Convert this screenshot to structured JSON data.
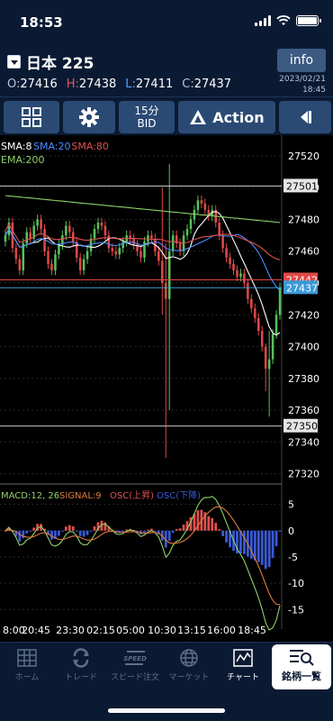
{
  "status_bar": {
    "time": "18:53"
  },
  "header": {
    "symbol": "日本 225",
    "info_label": "info",
    "ohlc": [
      {
        "label": "O:",
        "value": "27416",
        "color": "#b6c3d6"
      },
      {
        "label": "H:",
        "value": "27438",
        "color": "#e05a5a"
      },
      {
        "label": "L:",
        "value": "27411",
        "color": "#5aa0ff"
      },
      {
        "label": "C:",
        "value": "27437",
        "color": "#b6c3d6"
      }
    ],
    "date": "2023/02/21",
    "time": "18:45"
  },
  "toolbar": {
    "grid_icon": "grid-icon",
    "settings_icon": "gear-icon",
    "timeframe": "15分",
    "price_type": "BID",
    "action_label": "Action",
    "play_icon": "step-back-icon"
  },
  "chart_data": {
    "type": "candlestick",
    "title": "",
    "indicators": [
      {
        "label": "SMA:8",
        "color": "#ffffff"
      },
      {
        "label": "SMA:20",
        "color": "#4a8cff"
      },
      {
        "label": "SMA:80",
        "color": "#e05050"
      },
      {
        "label": "EMA:200",
        "color": "#8ed26a"
      }
    ],
    "y_ticks": [
      27520,
      27500,
      27480,
      27460,
      27440,
      27420,
      27400,
      27380,
      27360,
      27340,
      27320
    ],
    "ylim": [
      27313,
      27533
    ],
    "price_tags": [
      {
        "value": "27501",
        "price": 27501,
        "style": "white"
      },
      {
        "value": "27442",
        "price": 27442,
        "style": "red"
      },
      {
        "value": "27437",
        "price": 27437,
        "style": "blue"
      },
      {
        "value": "27350",
        "price": 27350,
        "style": "white"
      }
    ],
    "x_ticks": [
      "8:00",
      "20:45",
      "23:30",
      "02:15",
      "05:00",
      "10:30",
      "13:15",
      "16:00",
      "18:45"
    ],
    "closes": [
      27470,
      27478,
      27462,
      27455,
      27448,
      27465,
      27472,
      27468,
      27476,
      27480,
      27474,
      27460,
      27452,
      27448,
      27458,
      27464,
      27470,
      27476,
      27472,
      27466,
      27456,
      27448,
      27455,
      27460,
      27468,
      27474,
      27478,
      27476,
      27470,
      27462,
      27460,
      27458,
      27462,
      27466,
      27470,
      27468,
      27464,
      27460,
      27456,
      27466,
      27470,
      27468,
      27460,
      27454,
      27440,
      27430,
      27460,
      27470,
      27465,
      27460,
      27470,
      27474,
      27480,
      27486,
      27492,
      27490,
      27486,
      27482,
      27486,
      27478,
      27470,
      27462,
      27456,
      27452,
      27448,
      27444,
      27446,
      27440,
      27430,
      27424,
      27418,
      27410,
      27400,
      27386,
      27392,
      27408,
      27420,
      27437
    ],
    "macd": {
      "label": "MACD:12, 26",
      "signal_label": "SIGNAL:9",
      "osc_up_label": "OSC(上昇)",
      "osc_down_label": "OSC(下降)",
      "colors": {
        "macd": "#8ed26a",
        "signal": "#e07a40",
        "osc_up": "#e05050",
        "osc_down": "#3a5ad8"
      },
      "y_ticks": [
        5,
        0,
        -5,
        -10,
        -15
      ],
      "ylim": [
        -16.5,
        7
      ]
    }
  },
  "nav": {
    "items": [
      {
        "label": "ホーム",
        "icon": "home-icon"
      },
      {
        "label": "トレード",
        "icon": "trade-icon"
      },
      {
        "label": "スピード注文",
        "icon": "speed-icon"
      },
      {
        "label": "マーケット",
        "icon": "globe-icon"
      },
      {
        "label": "チャート",
        "icon": "chart-icon"
      }
    ],
    "last_label": "銘柄一覧",
    "last_icon": "list-search-icon"
  }
}
